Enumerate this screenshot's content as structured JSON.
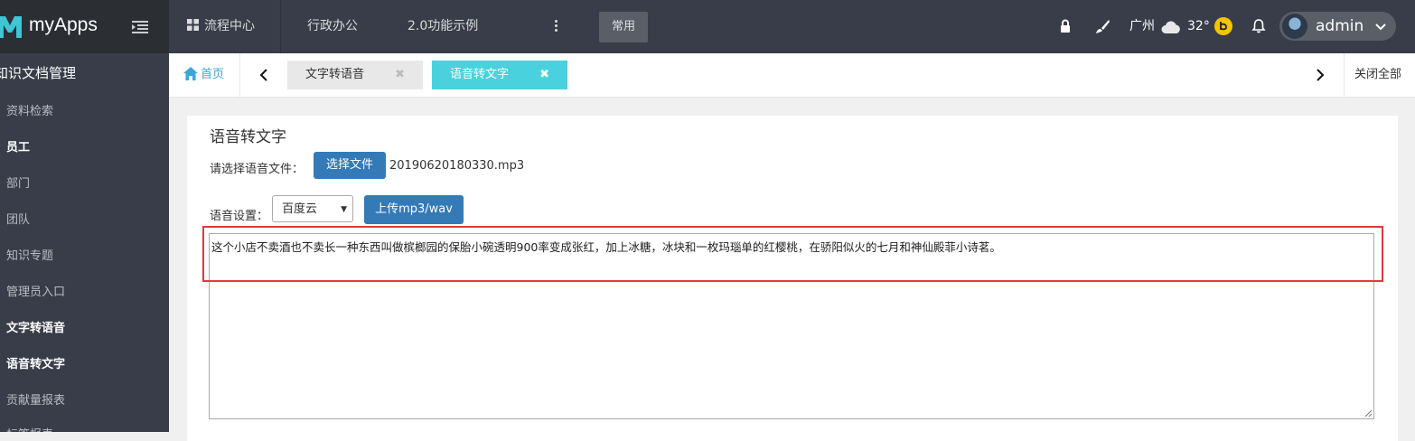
{
  "app": {
    "name": "myApps"
  },
  "topnav": {
    "items": [
      "流程中心",
      "行政办公",
      "2.0功能示例"
    ],
    "common_label": "常用",
    "city": "广州",
    "temperature": "32°",
    "user": "admin"
  },
  "sidebar": {
    "heading": "知识文档管理",
    "items": [
      {
        "label": "资料检索",
        "bold": false
      },
      {
        "label": "员工",
        "bold": true
      },
      {
        "label": "部门",
        "bold": false
      },
      {
        "label": "团队",
        "bold": false
      },
      {
        "label": "知识专题",
        "bold": false
      },
      {
        "label": "管理员入口",
        "bold": false
      },
      {
        "label": "文字转语音",
        "bold": true
      },
      {
        "label": "语音转文字",
        "bold": true
      },
      {
        "label": "贡献量报表",
        "bold": false
      },
      {
        "label": "标签报表",
        "bold": false
      }
    ]
  },
  "tabs": {
    "home_label": "首页",
    "open_tabs": [
      {
        "label": "文字转语音",
        "active": false
      },
      {
        "label": "语音转文字",
        "active": true
      }
    ],
    "close_all_label": "关闭全部"
  },
  "panel": {
    "title": "语音转文字",
    "file_prompt": "请选择语音文件：",
    "choose_file_label": "选择文件",
    "file_name": "20190620180330.mp3",
    "voice_setting_label": "语音设置：",
    "voice_engine": "百度云",
    "upload_label": "上传mp3/wav",
    "result_text": "这个小店不卖酒也不卖长一种东西叫做槟榔园的保胎小碗透明900率变成张红，加上冰糖，冰块和一枚玛瑙单的红樱桃，在骄阳似火的七月和神仙殿菲小诗茗。"
  },
  "colors": {
    "topbar": "#393d49",
    "logo_bg": "#2b2e33",
    "accent_teal": "#49d2de",
    "link_blue": "#3aa7d6",
    "button_blue": "#337ab7",
    "highlight_red": "#e53935"
  }
}
